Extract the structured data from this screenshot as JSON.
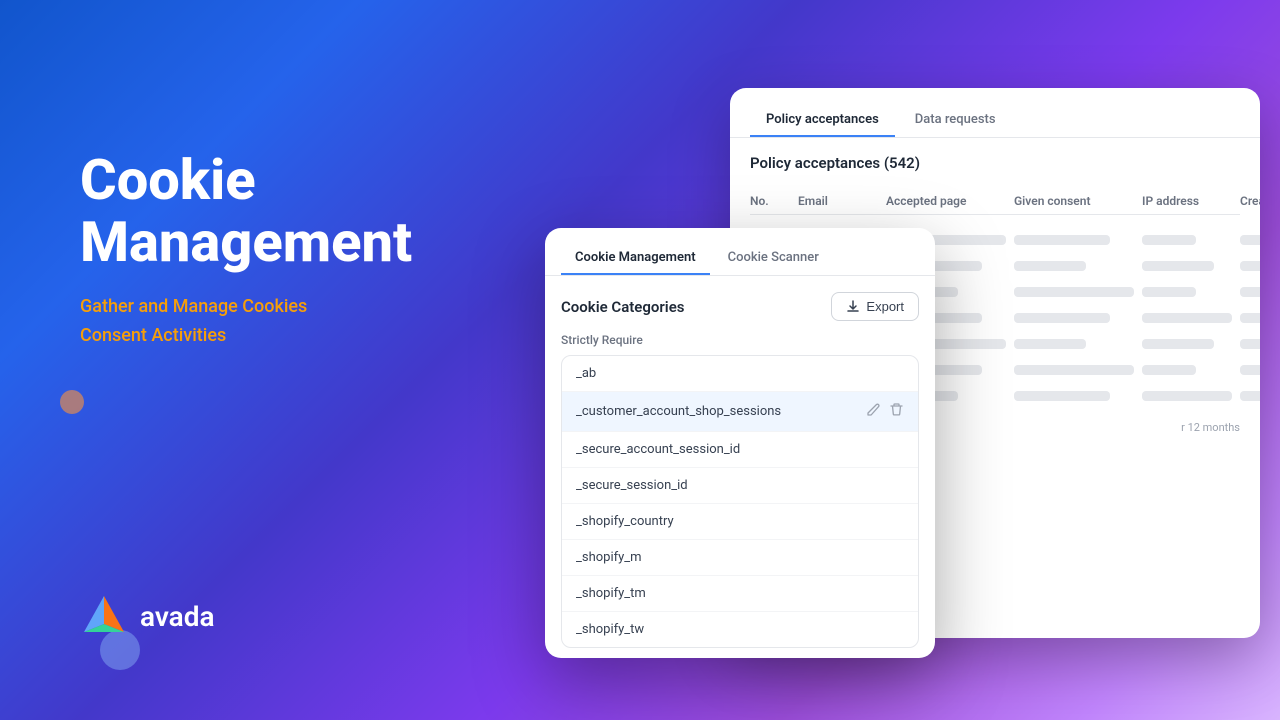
{
  "background": {
    "gradient_start": "#1a56db",
    "gradient_end": "#c77dff"
  },
  "left_panel": {
    "title_line1": "Cookie",
    "title_line2": "Management",
    "subtitle_line1": "Gather and Manage Cookies",
    "subtitle_line2": "Consent Activities"
  },
  "logo": {
    "text": "avada"
  },
  "policy_window": {
    "tabs": [
      {
        "label": "Policy acceptances",
        "active": true
      },
      {
        "label": "Data requests",
        "active": false
      }
    ],
    "title": "Policy acceptances (542)",
    "table_headers": [
      "No.",
      "Email",
      "Accepted page",
      "Given consent",
      "IP address",
      "Created at"
    ],
    "footer_text": "r 12 months"
  },
  "cookie_window": {
    "tabs": [
      {
        "label": "Cookie Management",
        "active": true
      },
      {
        "label": "Cookie Scanner",
        "active": false
      }
    ],
    "categories_title": "Cookie Categories",
    "export_button": "Export",
    "strictly_require_label": "Strictly Require",
    "cookies": [
      {
        "name": "_ab",
        "highlighted": false
      },
      {
        "name": "_customer_account_shop_sessions",
        "highlighted": true
      },
      {
        "name": "_secure_account_session_id",
        "highlighted": false
      },
      {
        "name": "_secure_session_id",
        "highlighted": false
      },
      {
        "name": "_shopify_country",
        "highlighted": false
      },
      {
        "name": "_shopify_m",
        "highlighted": false
      },
      {
        "name": "_shopify_tm",
        "highlighted": false
      },
      {
        "name": "_shopify_tw",
        "highlighted": false
      }
    ]
  }
}
